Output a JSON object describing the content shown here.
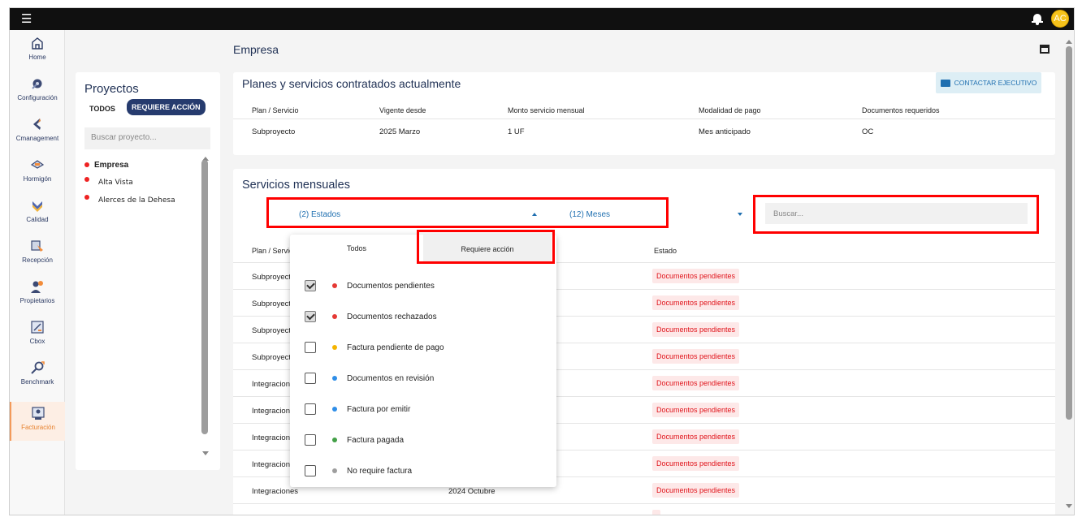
{
  "topbar": {
    "menu_icon": "hamburger-icon",
    "bell_icon": "bell-icon",
    "avatar_initials": "AC"
  },
  "sidebar": {
    "items": [
      {
        "label": "Home",
        "icon": "home-icon"
      },
      {
        "label": "Configuración",
        "icon": "settings-icon"
      },
      {
        "label": "Cmanagement",
        "icon": "cmanagement-icon"
      },
      {
        "label": "Hormigón",
        "icon": "concrete-icon"
      },
      {
        "label": "Calidad",
        "icon": "quality-icon"
      },
      {
        "label": "Recepción",
        "icon": "reception-icon"
      },
      {
        "label": "Propietarios",
        "icon": "owners-icon"
      },
      {
        "label": "Cbox",
        "icon": "cbox-icon"
      },
      {
        "label": "Benchmark",
        "icon": "benchmark-icon"
      },
      {
        "label": "Facturación",
        "icon": "billing-icon",
        "active": true
      }
    ]
  },
  "projects": {
    "title": "Proyectos",
    "toggle_all": "TODOS",
    "toggle_action": "REQUIERE ACCIÓN",
    "search_placeholder": "Buscar proyecto...",
    "items": [
      {
        "label": "Empresa",
        "status_color": "#e22222"
      },
      {
        "label": "Alta Vista",
        "status_color": "#e22222"
      },
      {
        "label": "Alerces de la Dehesa",
        "status_color": "#e22222"
      }
    ]
  },
  "main": {
    "title": "Empresa"
  },
  "plans": {
    "title": "Planes y servicios contratados actualmente",
    "contact_button": "CONTACTAR EJECUTIVO",
    "headers": [
      "Plan / Servicio",
      "Vigente desde",
      "Monto servicio mensual",
      "Modalidad de pago",
      "Documentos requeridos"
    ],
    "row": [
      "Subproyecto",
      "2025 Marzo",
      "1 UF",
      "Mes anticipado",
      "OC"
    ]
  },
  "services": {
    "title": "Servicios mensuales",
    "estados_filter": "(2) Estados",
    "meses_filter": "(12) Meses",
    "search_placeholder": "Buscar...",
    "headers": {
      "plan": "Plan / Servicio",
      "estado": "Estado"
    },
    "rows": [
      {
        "plan": "Subproyecto",
        "month": "",
        "estado": "Documentos pendientes"
      },
      {
        "plan": "Subproyecto",
        "month": "",
        "estado": "Documentos pendientes"
      },
      {
        "plan": "Subproyecto",
        "month": "",
        "estado": "Documentos pendientes"
      },
      {
        "plan": "Subproyecto",
        "month": "",
        "estado": "Documentos pendientes"
      },
      {
        "plan": "Integraciones",
        "month": "",
        "estado": "Documentos pendientes"
      },
      {
        "plan": "Integraciones",
        "month": "",
        "estado": "Documentos pendientes"
      },
      {
        "plan": "Integraciones",
        "month": "",
        "estado": "Documentos pendientes"
      },
      {
        "plan": "Integraciones",
        "month": "",
        "estado": "Documentos pendientes"
      },
      {
        "plan": "Integraciones",
        "month": "2024 Octubre",
        "estado": "Documentos pendientes"
      }
    ]
  },
  "dropdown": {
    "tab_all": "Todos",
    "tab_action": "Requiere acción",
    "options": [
      {
        "label": "Documentos pendientes",
        "checked": true,
        "color": "#e53935"
      },
      {
        "label": "Documentos rechazados",
        "checked": true,
        "color": "#e53935"
      },
      {
        "label": "Factura pendiente de pago",
        "checked": false,
        "color": "#f5b400"
      },
      {
        "label": "Documentos en revisión",
        "checked": false,
        "color": "#2f8ee8"
      },
      {
        "label": "Factura por emitir",
        "checked": false,
        "color": "#2f8ee8"
      },
      {
        "label": "Factura pagada",
        "checked": false,
        "color": "#43a047"
      },
      {
        "label": "No require factura",
        "checked": false,
        "color": "#9e9e9e"
      }
    ]
  },
  "colors": {
    "brand": "#263b6e",
    "accent": "#1f6fb0",
    "alert": "#e0141b",
    "highlight": "#ff0000"
  }
}
